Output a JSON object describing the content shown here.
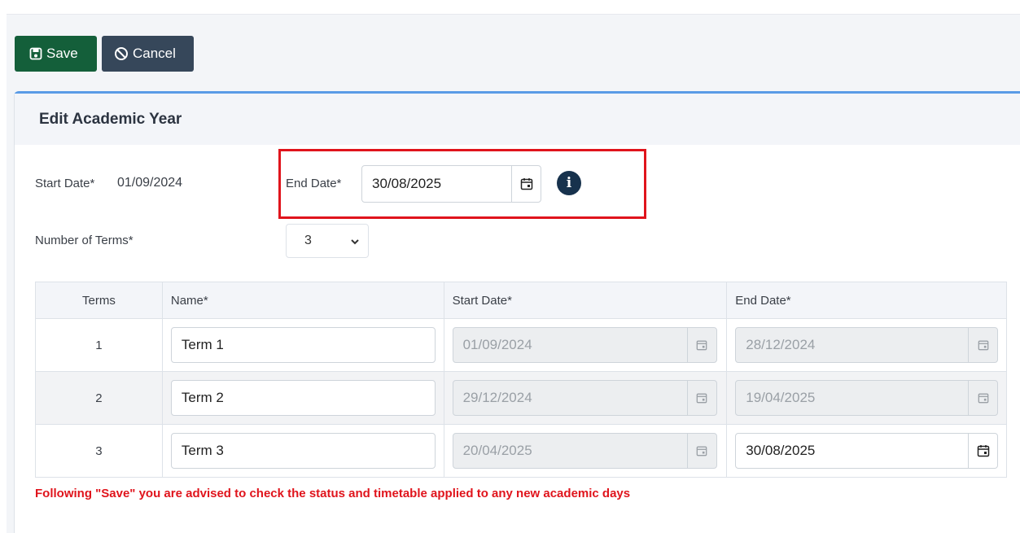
{
  "toolbar": {
    "save_label": "Save",
    "cancel_label": "Cancel"
  },
  "card": {
    "title": "Edit Academic Year"
  },
  "form": {
    "start_date_label": "Start Date*",
    "start_date_value": "01/09/2024",
    "end_date_label": "End Date*",
    "end_date_value": "30/08/2025",
    "num_terms_label": "Number of Terms*",
    "num_terms_value": "3"
  },
  "table": {
    "headers": [
      "Terms",
      "Name*",
      "Start Date*",
      "End Date*"
    ],
    "rows": [
      {
        "term": "1",
        "name": "Term 1",
        "start": "01/09/2024",
        "end": "28/12/2024",
        "end_editable": false
      },
      {
        "term": "2",
        "name": "Term 2",
        "start": "29/12/2024",
        "end": "19/04/2025",
        "end_editable": false
      },
      {
        "term": "3",
        "name": "Term 3",
        "start": "20/04/2025",
        "end": "30/08/2025",
        "end_editable": true
      }
    ]
  },
  "notice": "Following \"Save\" you are advised to check the status and timetable applied to any new academic days",
  "icons": {
    "save": "save-icon",
    "cancel": "cancel-icon",
    "calendar": "calendar-icon",
    "info": "info-icon",
    "chevron": "chevron-down-icon"
  },
  "colors": {
    "save_button": "#145f3a",
    "cancel_button": "#36475a",
    "card_accent": "#5a9be6",
    "highlight": "#e0141c",
    "notice": "#e0141c",
    "info_icon": "#17324d"
  }
}
